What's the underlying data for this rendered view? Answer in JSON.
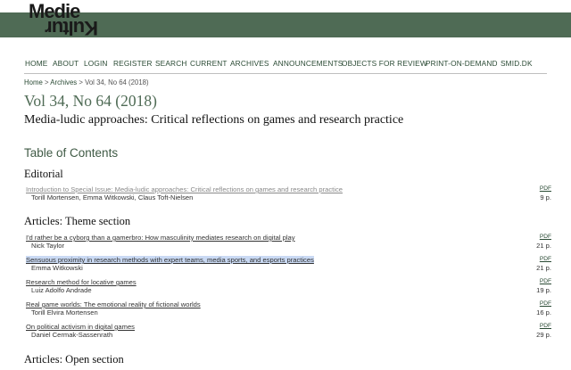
{
  "site": {
    "logo_text_top": "Medie",
    "logo_text_bottom": "Kultur",
    "band_color": "#4f6b55"
  },
  "nav": {
    "items": [
      "HOME",
      "ABOUT",
      "LOGIN",
      "REGISTER",
      "SEARCH",
      "CURRENT",
      "ARCHIVES",
      "ANNOUNCEMENTS",
      "OBJECTS FOR REVIEW",
      "PRINT-ON-DEMAND",
      "SMID.DK"
    ]
  },
  "breadcrumb": {
    "home": "Home",
    "sep1": " > ",
    "archives": "Archives",
    "sep2": " > ",
    "current": "Vol 34, No 64 (2018)"
  },
  "issue": {
    "title": "Vol 34, No 64 (2018)",
    "description": "Media-ludic approaches: Critical reflections on games and research practice"
  },
  "toc": {
    "title": "Table of Contents",
    "sections": [
      {
        "name": "Editorial",
        "articles": [
          {
            "title": "Introduction to Special Issue: Media-ludic approaches: Critical reflections on games and research practice",
            "authors": "Torill Mortensen, Emma Witkowski, Claus Toft-Nielsen",
            "pdf": "PDF",
            "pages": "9 p."
          }
        ]
      },
      {
        "name": "Articles: Theme section",
        "articles": [
          {
            "title": "I'd rather be a cyborg than a gamerbro: How masculinity mediates research on digital play",
            "authors": "Nick Taylor",
            "pdf": "PDF",
            "pages": "21 p."
          },
          {
            "title": "Sensuous proximity in research methods with expert teams, media sports, and esports practices",
            "authors": "Emma Witkowski",
            "pdf": "PDF",
            "pages": "21 p."
          },
          {
            "title": "Research method for locative games",
            "authors": "Luiz Adolfo Andrade",
            "pdf": "PDF",
            "pages": "19 p."
          },
          {
            "title": "Real game worlds: The emotional reality of fictional worlds",
            "authors": "Torill Elvira Mortensen",
            "pdf": "PDF",
            "pages": "16 p."
          },
          {
            "title": "On political activism in digital games",
            "authors": "Daniel Cermak-Sassenrath",
            "pdf": "PDF",
            "pages": "29 p."
          }
        ]
      },
      {
        "name": "Articles: Open section",
        "articles": []
      }
    ]
  }
}
